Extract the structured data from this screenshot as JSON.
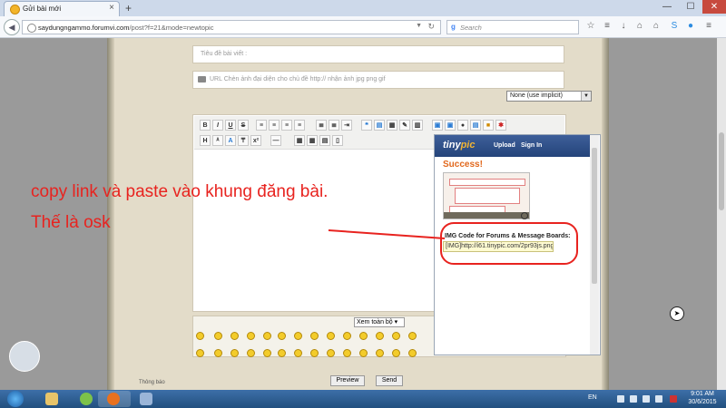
{
  "browser": {
    "tab_title": "Gửi bài mới",
    "tab_close": "×",
    "new_tab": "+",
    "url_host": "saydungngammo.forumvi.com",
    "url_path": "/post?f=21&mode=newtopic",
    "search_placeholder": "Search",
    "window_controls": {
      "minimize": "—",
      "maximize": "☐",
      "close": "✕"
    },
    "toolbar_icons": [
      "star-icon",
      "bookmarks-icon",
      "download-icon",
      "home-icon",
      "skype-icon",
      "chat-icon",
      "menu-icon"
    ]
  },
  "form": {
    "title_placeholder": "Tiêu đề bài viết :",
    "image_url_placeholder": "URL Chèn ảnh đại diện cho chủ đề http:// nhận ảnh jpg png gif",
    "icon_select": "None (use implicit)",
    "editor_row1": [
      "B",
      "I",
      "U",
      "S"
    ],
    "editor_row2": [
      "H",
      "A"
    ],
    "emoji_view_all": "Xem toàn bộ",
    "preview_label": "Preview",
    "send_label": "Send",
    "footer_hint": "Thông báo"
  },
  "tinypic": {
    "logo": "tiny",
    "logo_accent": "pic",
    "upload_label": "Upload",
    "signin_label": "Sign In",
    "success_text": "Success!",
    "img_code_label": "IMG Code for Forums & Message Boards:",
    "img_code_value": "[IMG]http://i61.tinypic.com/2pr93js.png[/IM"
  },
  "annotation": {
    "line1": "copy link và paste vào khung đăng bài.",
    "line2": "Thế là osk",
    "color": "#e8231f"
  },
  "taskbar": {
    "language": "EN",
    "time": "9:01 AM",
    "date": "30/6/2015"
  }
}
